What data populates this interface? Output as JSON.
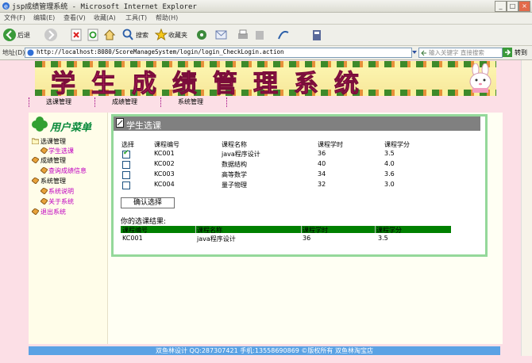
{
  "window": {
    "title": "jsp成绩管理系统 - Microsoft Internet Explorer"
  },
  "menu": [
    "文件(F)",
    "编辑(E)",
    "查看(V)",
    "收藏(A)",
    "工具(T)",
    "帮助(H)"
  ],
  "toolbar": {
    "back": "后退",
    "search": "搜索",
    "favorites": "收藏夹"
  },
  "address": {
    "label": "地址(D)",
    "url": "http://localhost:8080/ScoreManageSystem/login/login_CheckLogin.action",
    "search_placeholder": "输入关键字 直接搜索",
    "go": "转到"
  },
  "banner": {
    "title": "学生成绩管理系统"
  },
  "nav": [
    "选课管理",
    "成绩管理",
    "系统管理"
  ],
  "sidebar": {
    "title": "用户菜单",
    "groups": [
      {
        "label": "选课管理",
        "children": [
          "学生选课"
        ]
      },
      {
        "label": "成绩管理",
        "children": [
          "查询成绩信息"
        ]
      },
      {
        "label": "系统管理",
        "children": [
          "系统说明",
          "关于系统"
        ]
      },
      {
        "label": "退出系统",
        "children": []
      }
    ]
  },
  "panel": {
    "title": "学生选课",
    "columns": [
      "选择",
      "课程编号",
      "课程名称",
      "课程学时",
      "课程学分"
    ],
    "rows": [
      {
        "checked": true,
        "id": "KC001",
        "name": "java程序设计",
        "hours": "36",
        "credit": "3.5"
      },
      {
        "checked": false,
        "id": "KC002",
        "name": "数据结构",
        "hours": "40",
        "credit": "4.0"
      },
      {
        "checked": false,
        "id": "KC003",
        "name": "高等数学",
        "hours": "34",
        "credit": "3.6"
      },
      {
        "checked": false,
        "id": "KC004",
        "name": "量子物理",
        "hours": "32",
        "credit": "3.0"
      }
    ],
    "confirm": "确认选择",
    "result_label": "你的选课结果:",
    "result_columns": [
      "课程编号",
      "课程名称",
      "课程学时",
      "课程学分"
    ],
    "result_rows": [
      {
        "id": "KC001",
        "name": "java程序设计",
        "hours": "36",
        "credit": "3.5"
      }
    ]
  },
  "footer": {
    "text": "双鱼林设计  QQ:287307421 手机:13558690869 ©版权所有  双鱼林淘宝店"
  },
  "colors": {
    "panel_border": "#94d89a",
    "result_header": "#008000",
    "footer": "#5aa2e4",
    "page_bg": "#fcdfe6",
    "banner_text": "#e0287a"
  }
}
